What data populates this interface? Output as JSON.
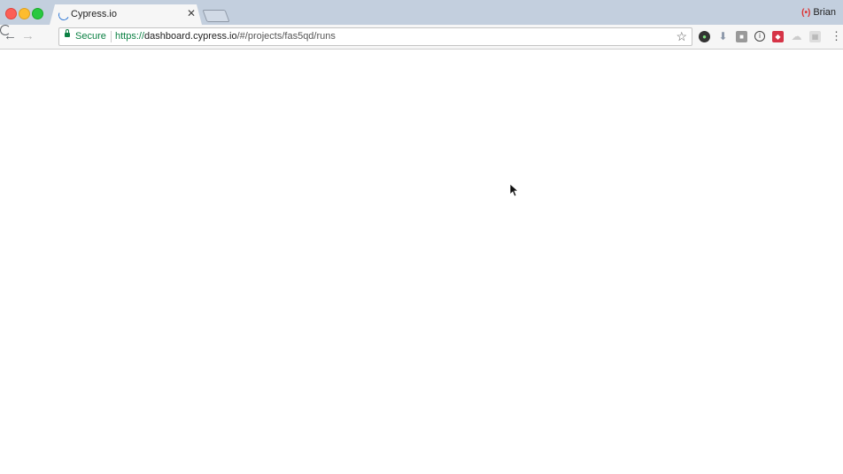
{
  "browser": {
    "tab": {
      "title": "Cypress.io",
      "close_glyph": "✕",
      "loading": true
    },
    "profile": {
      "name": "Brian",
      "icon": "cypress-logo-icon"
    },
    "nav": {
      "back_glyph": "←",
      "forward_glyph": "→"
    },
    "omnibox": {
      "security_label": "Secure",
      "url_scheme": "https://",
      "url_host": "dashboard.cypress.io",
      "url_path": "/#/projects/fas5qd/runs",
      "bookmark_glyph": "☆"
    },
    "extensions": [
      {
        "name": "ext-green-circle-icon",
        "glyph": "●"
      },
      {
        "name": "ext-download-icon",
        "glyph": "⬇"
      },
      {
        "name": "ext-square-icon",
        "glyph": "■"
      },
      {
        "name": "ext-info-icon",
        "glyph": "i"
      },
      {
        "name": "ext-red-badge-icon",
        "glyph": "◆"
      },
      {
        "name": "ext-cloud-icon",
        "glyph": "☁"
      },
      {
        "name": "ext-grid-icon",
        "glyph": "▦"
      }
    ],
    "menu_glyph": "⋮",
    "colors": {
      "titlebar": "#c3cfde",
      "secure_green": "#0b8043",
      "spinner_blue": "#2f78d6"
    }
  }
}
